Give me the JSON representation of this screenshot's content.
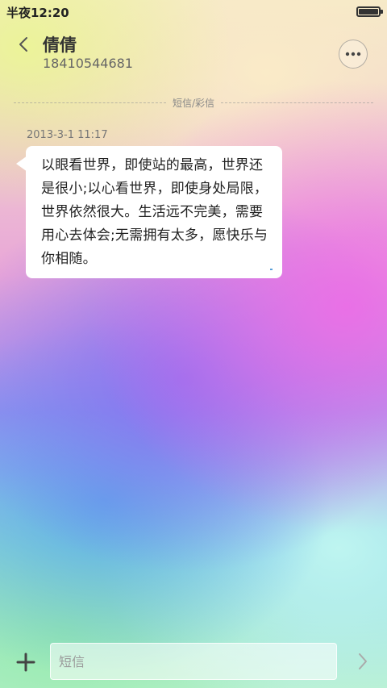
{
  "status_bar": {
    "time": "半夜12:20",
    "battery_level": 1.0
  },
  "header": {
    "back_icon": "chevron-left-icon",
    "contact_name": "倩倩",
    "contact_number": "18410544681",
    "more_icon": "more-horizontal-icon"
  },
  "conversation": {
    "divider_label": "短信/彩信",
    "messages": [
      {
        "timestamp": "2013-3-1 11:17",
        "text": "以眼看世界，即使站的最高，世界还是很小;以心看世界，即使身处局限，世界依然很大。生活远不完美，需要用心去体会;无需拥有太多，愿快乐与你相随。"
      }
    ]
  },
  "composer": {
    "add_icon": "plus-icon",
    "placeholder": "短信",
    "value": "",
    "send_icon": "chevron-right-icon"
  },
  "colors": {
    "bubble_background": "#ffffff",
    "text_primary": "#222222",
    "text_secondary": "#666666"
  }
}
